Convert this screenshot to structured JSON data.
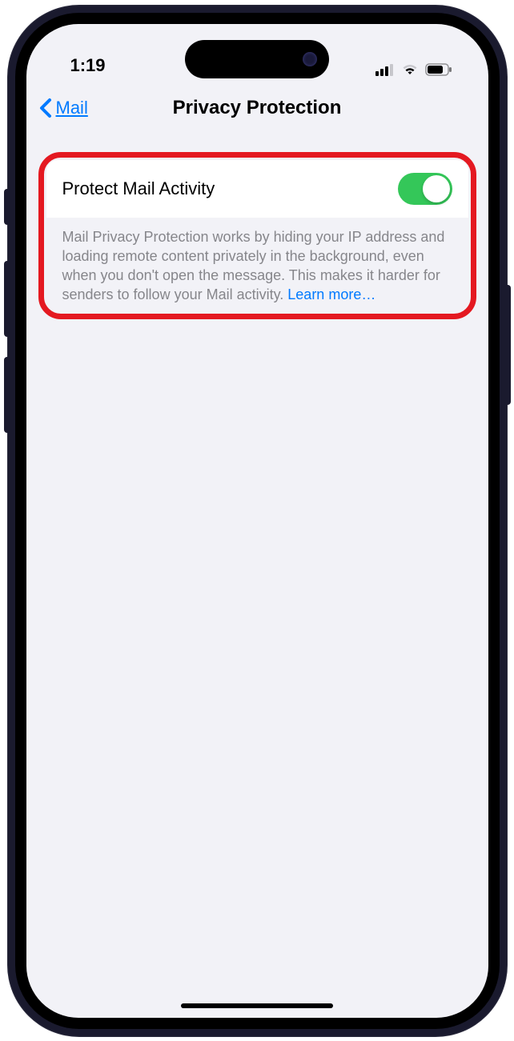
{
  "status": {
    "time": "1:19"
  },
  "nav": {
    "back_label": "Mail",
    "title": "Privacy Protection"
  },
  "setting": {
    "label": "Protect Mail Activity",
    "toggle_on": true,
    "description": "Mail Privacy Protection works by hiding your IP address and loading remote content privately in the background, even when you don't open the message. This makes it harder for senders to follow your Mail activity. ",
    "learn_more": "Learn more…"
  }
}
